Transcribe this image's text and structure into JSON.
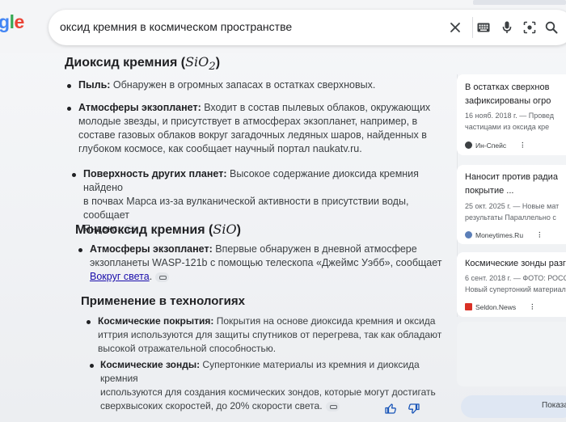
{
  "search": {
    "logo_tail": [
      "g",
      "l",
      "e"
    ],
    "query": "оксид кремния в космическом пространстве",
    "icons": [
      "close-icon",
      "keyboard-icon",
      "mic-icon",
      "lens-icon",
      "search-icon"
    ]
  },
  "sections": {
    "sio2": {
      "heading": "Диоксид кремния",
      "formula_base": "SiO",
      "formula_sub": "2",
      "items": [
        {
          "label": "Пыль:",
          "text": " Обнаружен в огромных запасах в остатках сверхновых."
        },
        {
          "label": "Атмосферы экзопланет:",
          "lines": [
            " Входит в состав пылевых облаков, окружающих",
            "молодые звезды, и присутствует в атмосферах экзопланет, например, в",
            "составе газовых облаков вокруг загадочных ледяных шаров, найденных в",
            "глубоком космосе, как сообщает научный портал naukatv.ru."
          ]
        },
        {
          "label": "Поверхность других планет:",
          "lines": [
            " Высокое содержание диоксида кремния найдено",
            "в почвах Марса из-за вулканической активности в присутствии воды, сообщает",
            "Яндекс."
          ]
        }
      ]
    },
    "sio": {
      "heading": "Монооксид кремния",
      "formula": "SiO",
      "items": [
        {
          "label": "Атмосферы экзопланет:",
          "lines": [
            " Впервые обнаружен в дневной атмосфере",
            "экзопланеты WASP-121b с помощью телескопа «Джеймс Уэбб», сообщает"
          ],
          "link": "Вокруг света",
          "after_link": "."
        }
      ]
    },
    "tech": {
      "heading": "Применение в технологиях",
      "items": [
        {
          "label": "Космические покрытия:",
          "lines": [
            " Покрытия на основе диоксида кремния и оксида",
            "иттрия используются для защиты спутников от перегрева, так как обладают",
            "высокой отражательной способностью."
          ]
        },
        {
          "label": "Космические зонды:",
          "lines": [
            " Супертонкие материалы из кремния и диоксида кремния",
            "используются для создания космических зондов, которые могут достигать",
            "сверхвысоких скоростей, до 20% скорости света."
          ]
        }
      ]
    }
  },
  "sources": [
    {
      "title_lines": [
        "В остатках сверхнов",
        "зафиксированы огро"
      ],
      "meta_lines": [
        "16 нояб. 2018 г. — Провед",
        "частицами из оксида кре"
      ],
      "site": "Ин-Спейс",
      "site_color": "#3c4043"
    },
    {
      "title_lines": [
        "Наносит против радиа",
        "покрытие ..."
      ],
      "meta_lines": [
        "25 окт. 2025 г. — Новые мат",
        "результаты Параллельно с"
      ],
      "site": "Moneytimes.Ru",
      "site_color": "#5b7fb8"
    },
    {
      "title_lines": [
        "Космические зонды разг"
      ],
      "meta_lines": [
        "6 сент. 2018 г. — ФОТО: РОСС",
        "Новый супертонкий материал"
      ],
      "site": "Seldon.News",
      "site_color": "#d93025"
    }
  ],
  "show_more": "Показа"
}
